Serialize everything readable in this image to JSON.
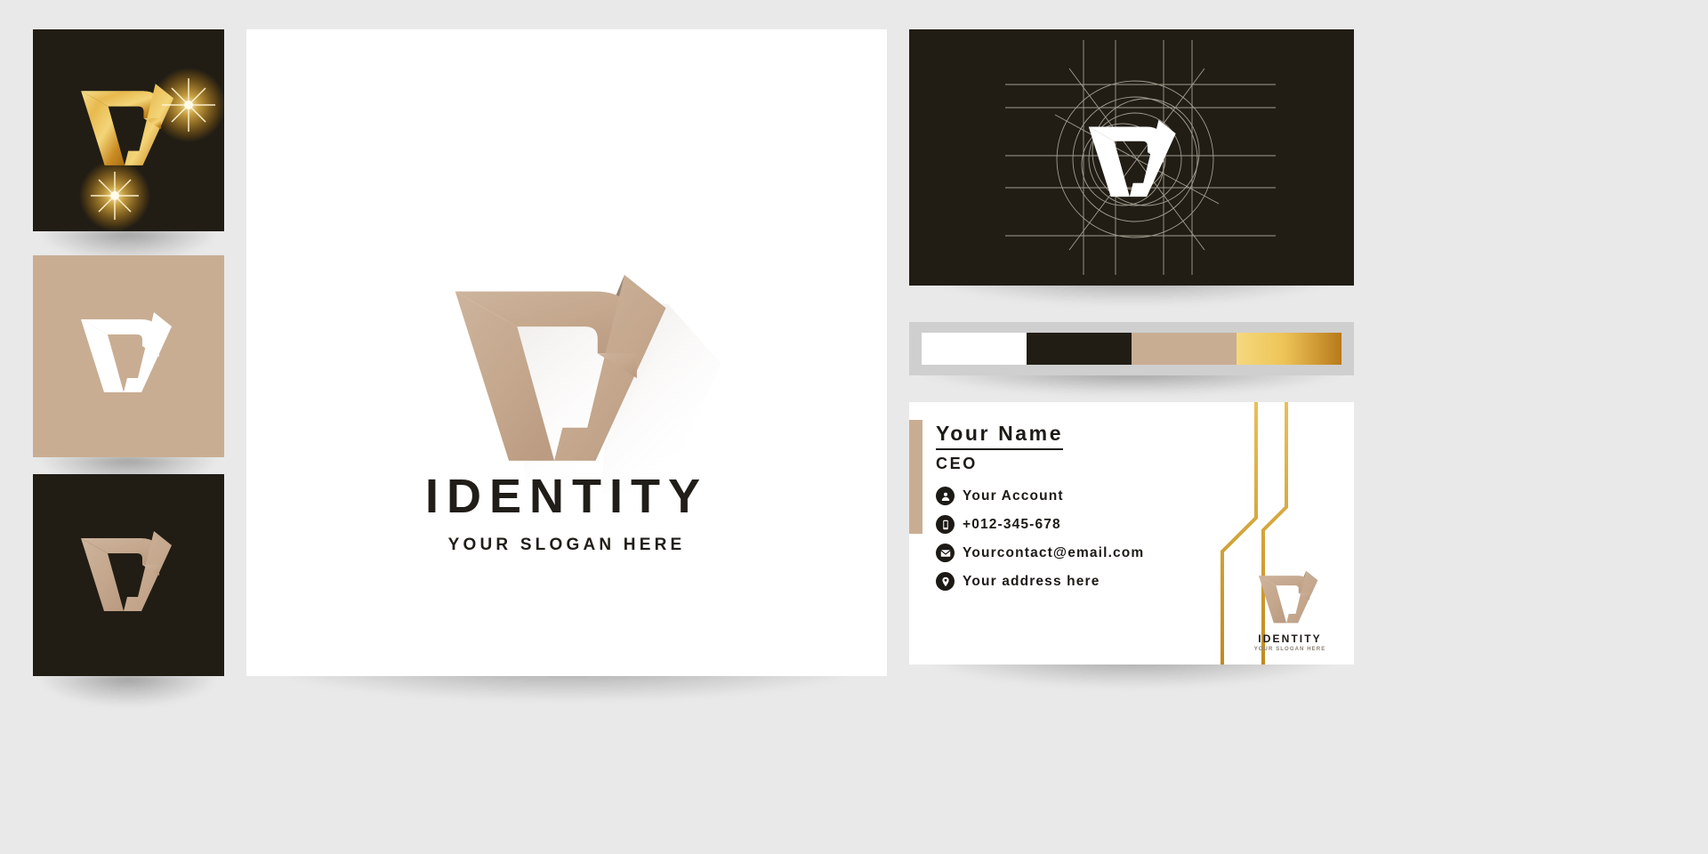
{
  "palette": {
    "background": "#e9e9e9",
    "dark": "#211d15",
    "tan": "#c9ad93",
    "white": "#ffffff",
    "gold_light": "#f2d06b",
    "gold_dark": "#b8791a",
    "text_dark": "#1d1a16"
  },
  "brand": {
    "name": "IDENTITY",
    "slogan": "YOUR SLOGAN HERE",
    "mini_name": "IDENTITY",
    "mini_slogan": "YOUR SLOGAN HERE"
  },
  "left_variants": [
    {
      "label": "gold-logo-on-dark",
      "background": "#211d15",
      "mark_style": "gold"
    },
    {
      "label": "white-logo-on-tan",
      "background": "#c9ad93",
      "mark_style": "white"
    },
    {
      "label": "tan-logo-on-dark",
      "background": "#211d15",
      "mark_style": "tan"
    }
  ],
  "grid_card": {
    "label": "logo-construction-grid",
    "background": "#211d15",
    "mark_style": "white"
  },
  "color_swatches": [
    {
      "name": "white",
      "hex": "#ffffff"
    },
    {
      "name": "black",
      "hex": "#211d15"
    },
    {
      "name": "tan",
      "hex": "#c9ad93"
    },
    {
      "name": "gold",
      "hex": "#f2d06b"
    }
  ],
  "business_card": {
    "name": "Your Name",
    "role": "CEO",
    "contacts": [
      {
        "icon": "user-icon",
        "text": "Your Account"
      },
      {
        "icon": "phone-icon",
        "text": "+012-345-678"
      },
      {
        "icon": "envelope-icon",
        "text": "Yourcontact@email.com"
      },
      {
        "icon": "location-icon",
        "text": "Your address here"
      }
    ]
  }
}
